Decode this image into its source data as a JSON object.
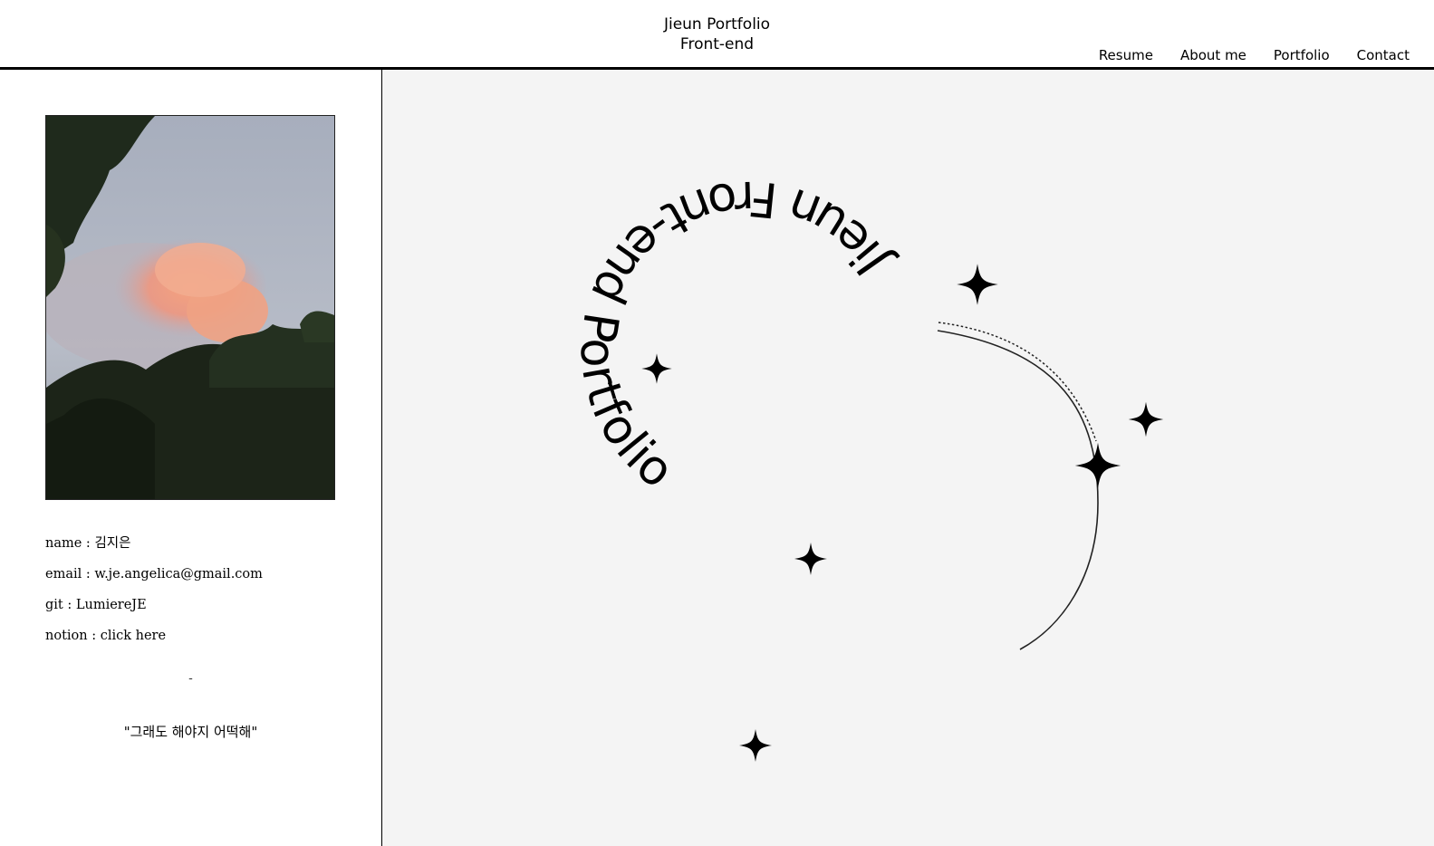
{
  "header": {
    "title_line1": "Jieun Portfolio",
    "title_line2": "Front-end",
    "nav": [
      {
        "label": "Resume"
      },
      {
        "label": "About me"
      },
      {
        "label": "Portfolio"
      },
      {
        "label": "Contact"
      }
    ]
  },
  "profile": {
    "photo": "sunset-clouds-trees-photo",
    "info": [
      {
        "key": "name",
        "sep": " : ",
        "value": "김지은"
      },
      {
        "key": "email",
        "sep": " : ",
        "value": "w.je.angelica@gmail.com"
      },
      {
        "key": "git",
        "sep": " : ",
        "value": "LumiereJE"
      },
      {
        "key": "notion",
        "sep": " : ",
        "value": "click here"
      }
    ],
    "divider": "-",
    "quote": "\"그래도 해야지 어떡해\""
  },
  "hero": {
    "circle_text": "Jieun Front-end Portfolio",
    "icons": [
      "sparkle-icon"
    ],
    "colors": {
      "background": "#f4f4f4",
      "ink": "#000000"
    }
  }
}
